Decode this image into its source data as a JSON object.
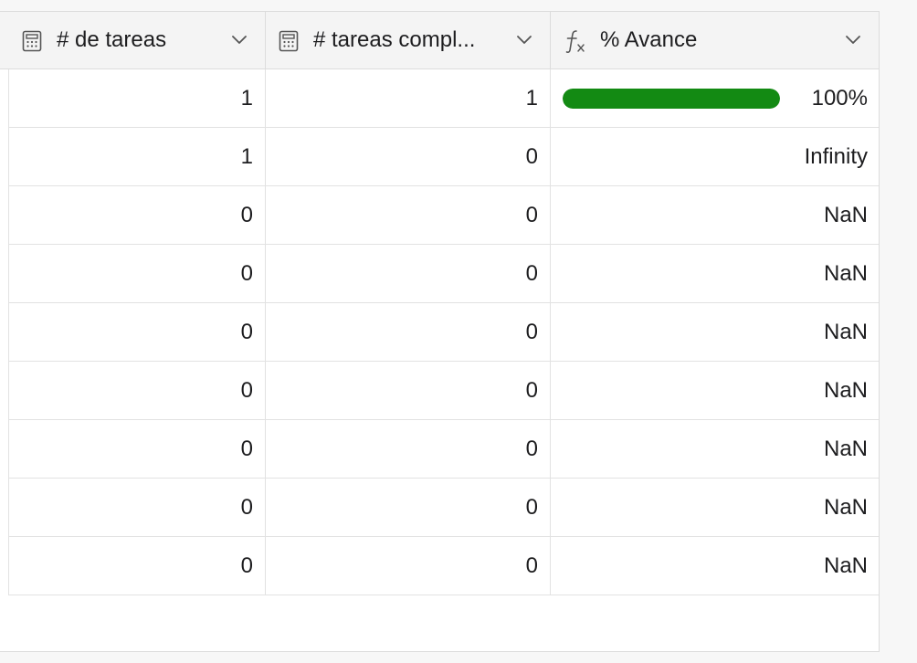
{
  "columns": [
    {
      "name": "# de tareas",
      "icon": "calculator-icon"
    },
    {
      "name": "# tareas compl...",
      "icon": "calculator-icon"
    },
    {
      "name": "% Avance",
      "icon": "formula-icon"
    }
  ],
  "rows": [
    {
      "tareas": "1",
      "completadas": "1",
      "avance": "100%",
      "progress": 1.0
    },
    {
      "tareas": "1",
      "completadas": "0",
      "avance": "Infinity"
    },
    {
      "tareas": "0",
      "completadas": "0",
      "avance": "NaN"
    },
    {
      "tareas": "0",
      "completadas": "0",
      "avance": "NaN"
    },
    {
      "tareas": "0",
      "completadas": "0",
      "avance": "NaN"
    },
    {
      "tareas": "0",
      "completadas": "0",
      "avance": "NaN"
    },
    {
      "tareas": "0",
      "completadas": "0",
      "avance": "NaN"
    },
    {
      "tareas": "0",
      "completadas": "0",
      "avance": "NaN"
    },
    {
      "tareas": "0",
      "completadas": "0",
      "avance": "NaN"
    }
  ],
  "colors": {
    "progress_fill": "#138a13",
    "header_bg": "#f4f4f4",
    "border": "#dcdcdc"
  }
}
